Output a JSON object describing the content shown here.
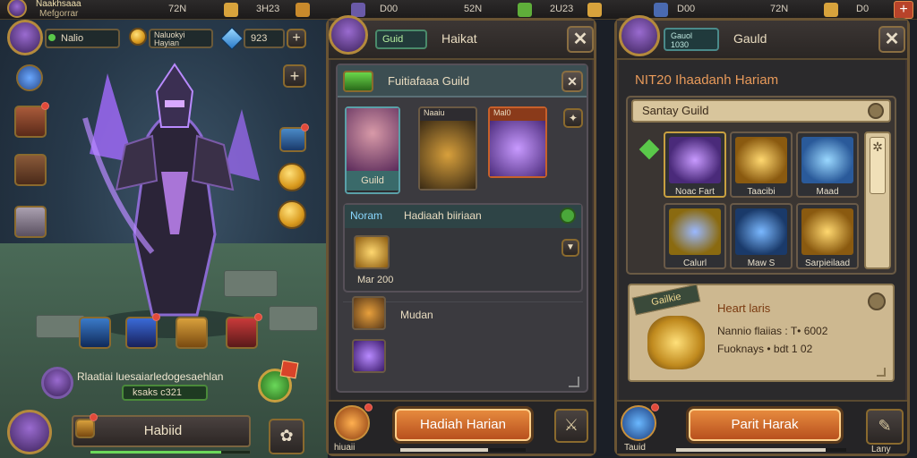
{
  "topbar": {
    "left_title": "Naakhsaaa",
    "left_sub": "Mefgorrar",
    "v1": "72N",
    "v2": "3H23",
    "v3": "D00",
    "v4": "52N",
    "v5": "2U23",
    "v6": "D00",
    "v7": "72N",
    "v8": "D0",
    "close": "+"
  },
  "left": {
    "player_name": "Nalio",
    "coin_label": "Naluokyi\nHayian",
    "gem_value": "923",
    "plus": "+",
    "task_text": "Rlaatiai luesaiarledogesaehlan",
    "task_value": "ksaks c321",
    "bottom_label": "Habiid"
  },
  "panel1": {
    "tab": "Guid",
    "title": "Haikat",
    "close": "✕",
    "inner_title": "Fuitiafaaa Guild",
    "inner_close": "✕",
    "char1_label": "Guild",
    "char2_label": "Naaiu",
    "char3_label": "Mal0",
    "row_badge": "Noram",
    "row_title": "Hadiaah biiriaan",
    "row_item_label": "Mar 200",
    "row2_label": "Mudan",
    "claim_button": "Hadiah Harian",
    "bottom_left": "hiuaii"
  },
  "panel2": {
    "badge_top": "Gauol",
    "badge_num": "1030",
    "title": "Gauld",
    "close": "✕",
    "heading": "NIT20 Ihaadanh Hariam",
    "section": "Santay Guild",
    "items": [
      "Noac Fart",
      "Taacibi",
      "Maad",
      "Calurl",
      "Maw S",
      "Sarpieilaad"
    ],
    "reward_tag": "Gailkie",
    "reward_title": "Heart laris",
    "reward_line1": "Nannio flaiias : T• 6002",
    "reward_line2": "Fuoknays • bdt 1 02",
    "action_button": "Parit Harak",
    "bottom_left": "Tauid",
    "bottom_right": "Lany"
  }
}
